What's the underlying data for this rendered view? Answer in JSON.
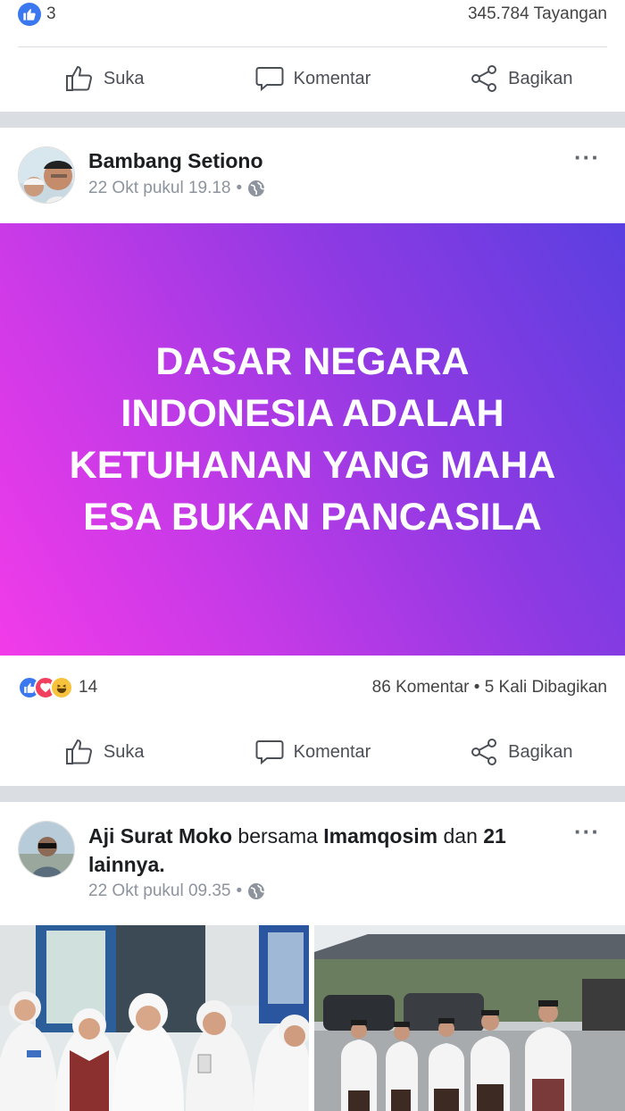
{
  "top_post": {
    "like_count": "3",
    "views": "345.784 Tayangan"
  },
  "actions": {
    "like": "Suka",
    "comment": "Komentar",
    "share": "Bagikan"
  },
  "post1": {
    "author": "Bambang Setiono",
    "timestamp": "22 Okt pukul 19.18",
    "more": "···",
    "banner_text": "DASAR NEGARA INDONESIA ADALAH KETUHANAN YANG MAHA ESA BUKAN PANCASILA",
    "reaction_count": "14",
    "comments": "86 Komentar",
    "shares": "5 Kali Dibagikan"
  },
  "post2": {
    "author": "Aji Surat Moko",
    "with_word": "bersama",
    "tagged": "Imamqosim",
    "and_word": "dan",
    "others": "21 lainnya",
    "timestamp": "22 Okt pukul 09.35",
    "more": "···"
  },
  "colors": {
    "like_blue": "#3b78f0",
    "love_red": "#f0405e",
    "haha_yellow": "#f7c33c",
    "banner_start": "#f23be9",
    "banner_end": "#5a3fe0",
    "separator": "#dadde1"
  },
  "icons": [
    "like-icon",
    "comment-icon",
    "share-icon",
    "globe-icon",
    "more-icon"
  ]
}
